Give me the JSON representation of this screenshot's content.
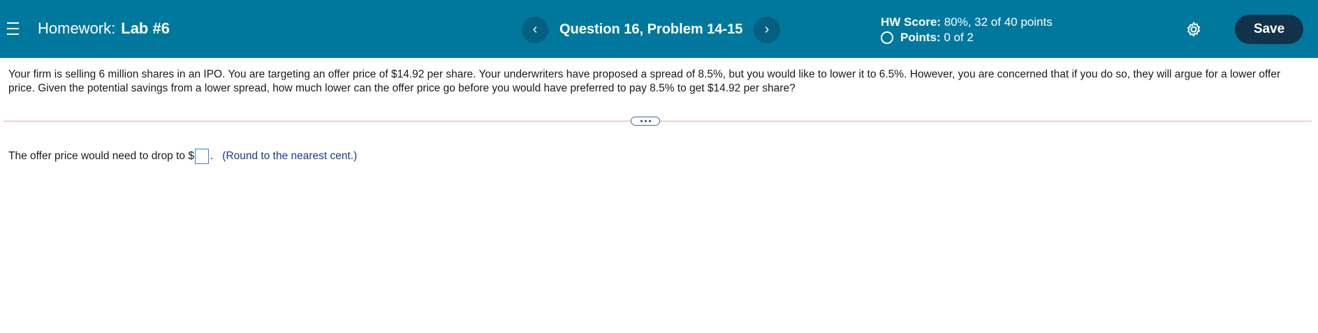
{
  "header": {
    "menu_icon": "hamburger-icon",
    "hw_prefix": "Homework:",
    "hw_name": "Lab #6",
    "question_title": "Question 16, Problem 14-15",
    "prev_label": "‹",
    "next_label": "›",
    "hw_score_label": "HW Score:",
    "hw_score_value": "80%, 32 of 40 points",
    "points_label": "Points:",
    "points_value": "0 of 2",
    "settings_icon": "gear-icon",
    "save_label": "Save"
  },
  "question": {
    "text": "Your firm is selling 6 million shares in an IPO. You are targeting an offer price of $14.92 per share. Your underwriters have proposed a spread of 8.5%, but you would like to lower it to 6.5%. However, you are concerned that if you do so, they will argue for a lower offer price. Given the potential savings from a lower spread, how much lower can the offer price go before you would have preferred to pay 8.5% to get $14.92 per share?"
  },
  "answer": {
    "prefix": "The offer price would need to drop to $",
    "suffix": ".",
    "input_value": "",
    "hint": "(Round to the nearest cent.)"
  },
  "colors": {
    "header_bg": "#00789e",
    "nav_button_bg": "#055f80",
    "save_button_bg": "#12324a",
    "hint_text": "#1a3a8a"
  }
}
